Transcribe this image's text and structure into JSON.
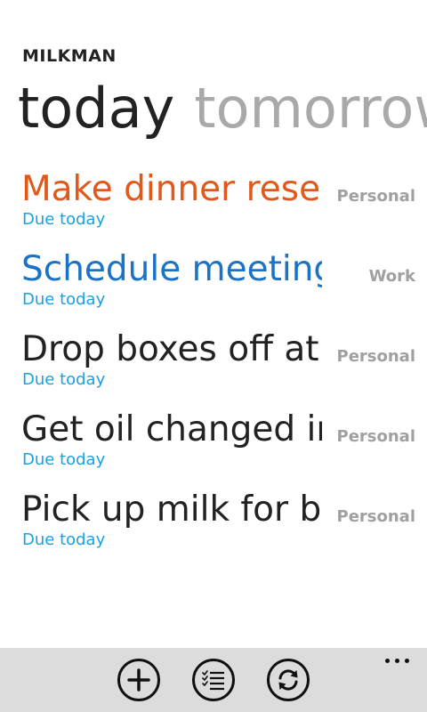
{
  "app": {
    "title": "MILKMAN"
  },
  "pivot": {
    "active": "today",
    "next": "tomorrow"
  },
  "tasks": [
    {
      "title": "Make dinner reservations",
      "due": "Due today",
      "tag": "Personal",
      "color": "#e0591b"
    },
    {
      "title": "Schedule meeting",
      "due": "Due today",
      "tag": "Work",
      "color": "#1a73c5"
    },
    {
      "title": "Drop boxes off at post office",
      "due": "Due today",
      "tag": "Personal",
      "color": "#222222"
    },
    {
      "title": "Get oil changed in car",
      "due": "Due today",
      "tag": "Personal",
      "color": "#222222"
    },
    {
      "title": "Pick up milk for breakfast",
      "due": "Due today",
      "tag": "Personal",
      "color": "#222222"
    }
  ],
  "appbar": {
    "buttons": [
      {
        "icon": "add-icon"
      },
      {
        "icon": "list-icon"
      },
      {
        "icon": "sync-icon"
      }
    ],
    "more_icon": "more-icon"
  }
}
